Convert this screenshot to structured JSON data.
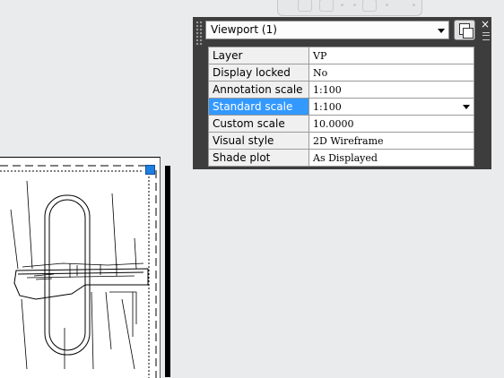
{
  "palette": {
    "selected_object": "Viewport (1)",
    "close_glyph": "×",
    "properties": [
      {
        "label": "Layer",
        "value": "VP"
      },
      {
        "label": "Display locked",
        "value": "No"
      },
      {
        "label": "Annotation scale",
        "value": "1:100"
      },
      {
        "label": "Standard scale",
        "value": "1:100",
        "selected": true
      },
      {
        "label": "Custom scale",
        "value": "10.0000"
      },
      {
        "label": "Visual style",
        "value": "2D Wireframe"
      },
      {
        "label": "Shade plot",
        "value": "As Displayed"
      }
    ]
  },
  "colors": {
    "palette_bg": "#3d3d3d",
    "selection": "#3399ff",
    "grip": "#1e7fe0",
    "canvas_bg": "#eaebec"
  },
  "icons": [
    "close-icon",
    "palette-menu-icon",
    "quick-select-icon",
    "dropdown-arrow-icon",
    "grip-handle-icon",
    "navigation-bar-icon"
  ]
}
